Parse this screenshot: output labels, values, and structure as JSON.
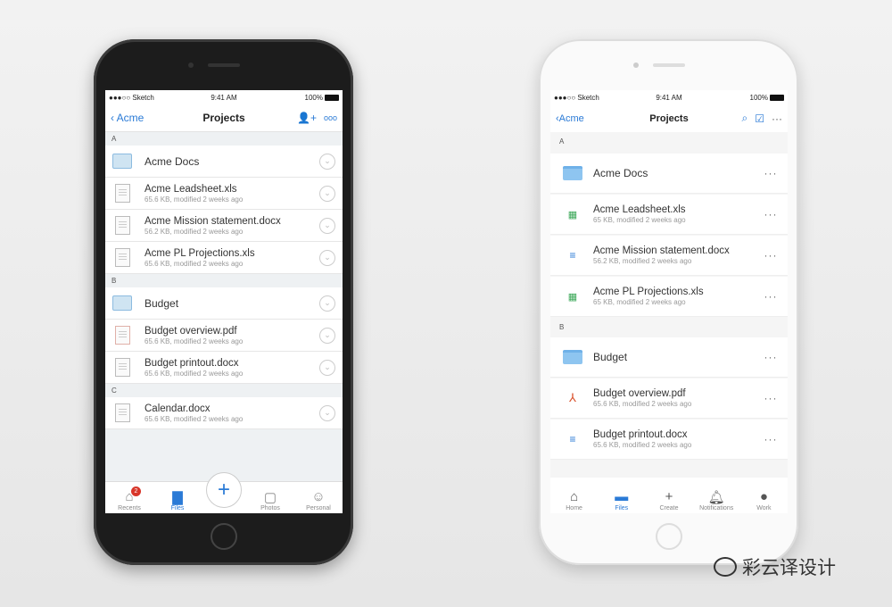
{
  "status": {
    "carrier": "●●●○○ Sketch",
    "time": "9:41 AM",
    "battery": "100%"
  },
  "left": {
    "nav": {
      "back": "Acme",
      "title": "Projects",
      "add_person_icon": "person-add-icon",
      "more_icon": "ellipsis-icon"
    },
    "sections": [
      {
        "letter": "A",
        "items": [
          {
            "name": "Acme Docs",
            "type": "folder"
          },
          {
            "name": "Acme Leadsheet.xls",
            "meta": "65.6 KB, modified 2 weeks ago",
            "type": "xls"
          },
          {
            "name": "Acme Mission statement.docx",
            "meta": "56.2 KB, modified 2 weeks ago",
            "type": "docx"
          },
          {
            "name": "Acme PL Projections.xls",
            "meta": "65.6 KB, modified 2 weeks ago",
            "type": "xls"
          }
        ]
      },
      {
        "letter": "B",
        "items": [
          {
            "name": "Budget",
            "type": "folder"
          },
          {
            "name": "Budget overview.pdf",
            "meta": "65.6 KB, modified 2 weeks ago",
            "type": "pdf"
          },
          {
            "name": "Budget printout.docx",
            "meta": "65.6 KB, modified 2 weeks ago",
            "type": "docx"
          }
        ]
      },
      {
        "letter": "C",
        "items": [
          {
            "name": "Calendar.docx",
            "meta": "65.6 KB, modified 2 weeks ago",
            "type": "docx"
          }
        ]
      }
    ],
    "tabs": {
      "recents": "Recents",
      "recents_badge": "2",
      "files": "Files",
      "photos": "Photos",
      "personal": "Personal"
    }
  },
  "right": {
    "nav": {
      "back": "Acme",
      "title": "Projects"
    },
    "sections": [
      {
        "letter": "A",
        "items": [
          {
            "name": "Acme Docs",
            "type": "folder"
          },
          {
            "name": "Acme Leadsheet.xls",
            "meta": "65 KB, modified 2 weeks ago",
            "type": "xls"
          },
          {
            "name": "Acme Mission statement.docx",
            "meta": "56.2 KB, modified 2 weeks ago",
            "type": "docx"
          },
          {
            "name": "Acme PL Projections.xls",
            "meta": "65 KB, modified 2 weeks ago",
            "type": "xls"
          }
        ]
      },
      {
        "letter": "B",
        "items": [
          {
            "name": "Budget",
            "type": "folder"
          },
          {
            "name": "Budget overview.pdf",
            "meta": "65.6 KB, modified 2 weeks ago",
            "type": "pdf"
          },
          {
            "name": "Budget printout.docx",
            "meta": "65.6 KB, modified 2 weeks ago",
            "type": "docx"
          }
        ]
      }
    ],
    "tabs": {
      "home": "Home",
      "files": "Files",
      "create": "Create",
      "notifications": "Notifications",
      "work": "Work"
    }
  },
  "colors": {
    "accent": "#2a7ad6",
    "badge": "#d8362a",
    "xls": "#3aa757",
    "pdf": "#d9502a"
  },
  "watermark": "彩云译设计"
}
